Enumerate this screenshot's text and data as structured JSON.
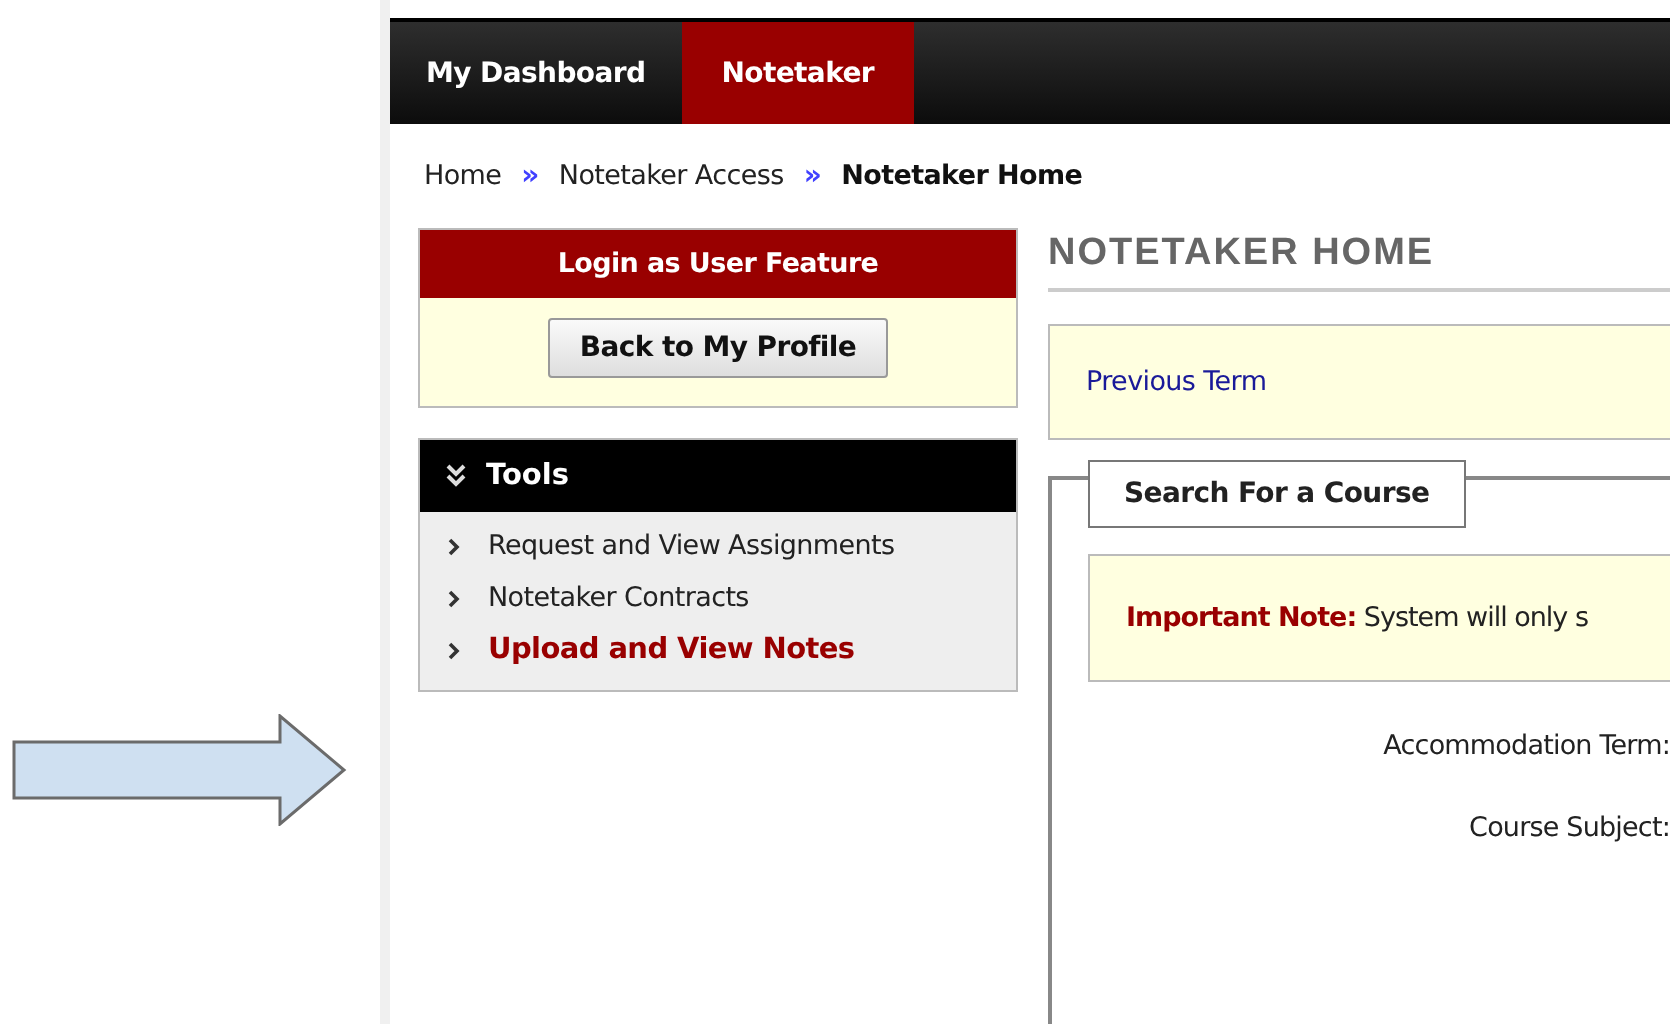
{
  "nav_tabs": [
    {
      "label": "My Dashboard",
      "selected": false
    },
    {
      "label": "Notetaker",
      "selected": true
    }
  ],
  "breadcrumb": [
    {
      "label": "Home",
      "current": false
    },
    {
      "label": "Notetaker Access",
      "current": false
    },
    {
      "label": "Notetaker Home",
      "current": true
    }
  ],
  "breadcrumb_separator": "»",
  "login_panel": {
    "title": "Login as User Feature",
    "button": "Back to My Profile"
  },
  "tools": {
    "title": "Tools",
    "expanded": true,
    "items": [
      {
        "label": "Request and View Assignments",
        "selected": false
      },
      {
        "label": "Notetaker Contracts",
        "selected": false
      },
      {
        "label": "Upload and View Notes",
        "selected": true
      }
    ]
  },
  "page_title": "NOTETAKER HOME",
  "term_link": "Previous Term",
  "search_section": {
    "legend": "Search For a Course",
    "note": "**Important Note:** System will only s",
    "fields": [
      "Accommodation Term:",
      "Course Subject:"
    ]
  }
}
